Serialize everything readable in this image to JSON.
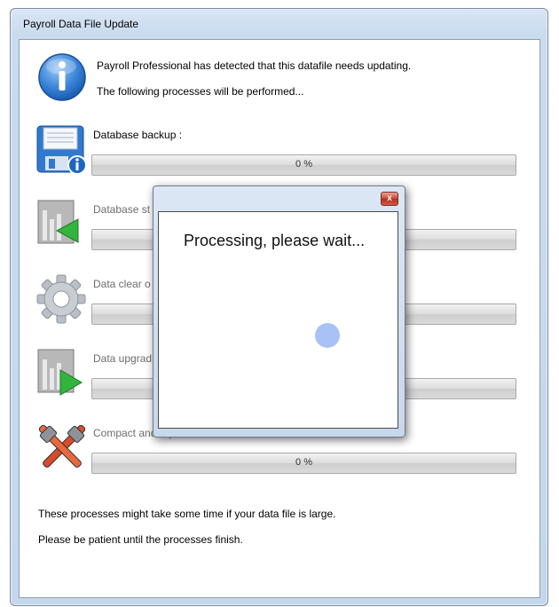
{
  "window": {
    "title": "Payroll Data File Update"
  },
  "intro": {
    "line1": "Payroll Professional has detected that this datafile needs updating.",
    "line2": "The following processes will be performed..."
  },
  "steps": [
    {
      "label": "Database backup :",
      "progress_text": "0 %",
      "progress": 0,
      "icon": "floppy-disk-info-icon"
    },
    {
      "label": "Database st",
      "progress_text": "",
      "progress": 0,
      "icon": "chart-arrow-left-icon"
    },
    {
      "label": "Data clear o",
      "progress_text": "",
      "progress": 0,
      "icon": "gear-icon"
    },
    {
      "label": "Data upgrad",
      "progress_text": "",
      "progress": 0,
      "icon": "chart-arrow-right-icon"
    },
    {
      "label": "Compact and repair database :",
      "progress_text": "0 %",
      "progress": 0,
      "icon": "tools-icon"
    }
  ],
  "footer": {
    "line1": "These processes might take some time if your data file is large.",
    "line2": "Please be patient until the processes finish."
  },
  "modal": {
    "message": "Processing, please wait...",
    "close_glyph": "x"
  }
}
